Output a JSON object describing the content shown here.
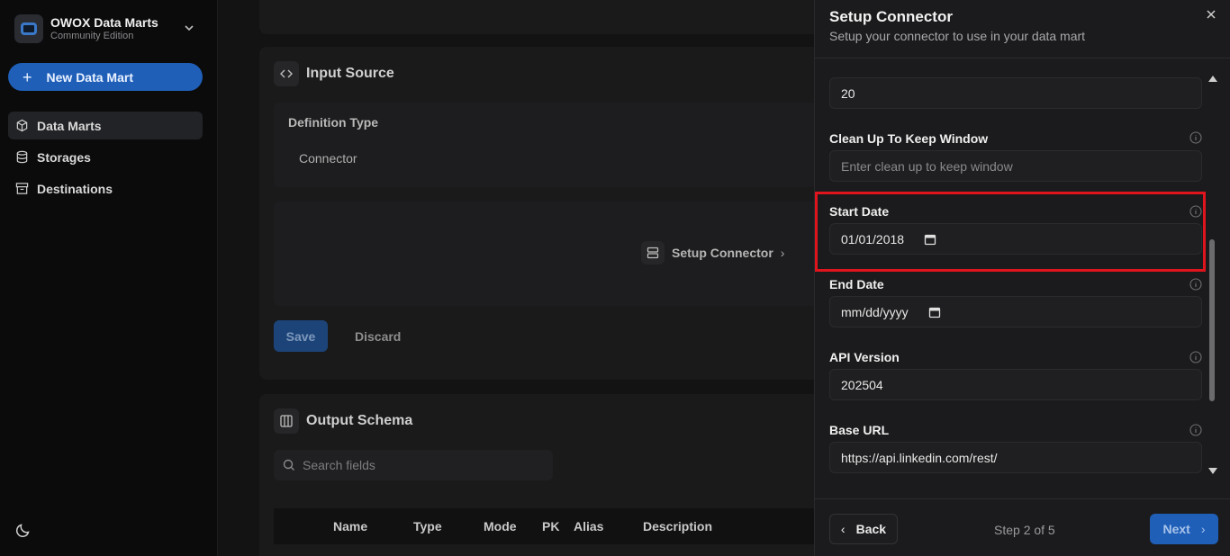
{
  "sidebar": {
    "brand_title": "OWOX Data Marts",
    "brand_subtitle": "Community Edition",
    "new_button_label": "New Data Mart",
    "items": [
      {
        "label": "Data Marts",
        "icon": "cube-icon",
        "active": true
      },
      {
        "label": "Storages",
        "icon": "database-icon",
        "active": false
      },
      {
        "label": "Destinations",
        "icon": "archive-icon",
        "active": false
      }
    ],
    "theme_icon": "moon-icon"
  },
  "main": {
    "input_source": {
      "title": "Input Source",
      "definition_type_label": "Definition Type",
      "definition_type_value": "Connector",
      "setup_connector_label": "Setup Connector",
      "save_label": "Save",
      "discard_label": "Discard"
    },
    "output_schema": {
      "title": "Output Schema",
      "search_placeholder": "Search fields",
      "columns": [
        "Name",
        "Type",
        "Mode",
        "PK",
        "Alias",
        "Description"
      ]
    }
  },
  "drawer": {
    "title": "Setup Connector",
    "subtitle": "Setup your connector to use in your data mart",
    "fields": [
      {
        "label": "",
        "value": "20"
      },
      {
        "label": "Clean Up To Keep Window",
        "value": "",
        "placeholder": "Enter clean up to keep window"
      },
      {
        "label": "Start Date",
        "value": "01/01/2018"
      },
      {
        "label": "End Date",
        "value": "mm/dd/yyyy"
      },
      {
        "label": "API Version",
        "value": "202504"
      },
      {
        "label": "Base URL",
        "value": "https://api.linkedin.com/rest/"
      }
    ],
    "back_label": "Back",
    "step_text": "Step 2 of 5",
    "next_label": "Next",
    "highlight_color": "#e0141c",
    "accent_color": "#1f5fb8"
  }
}
